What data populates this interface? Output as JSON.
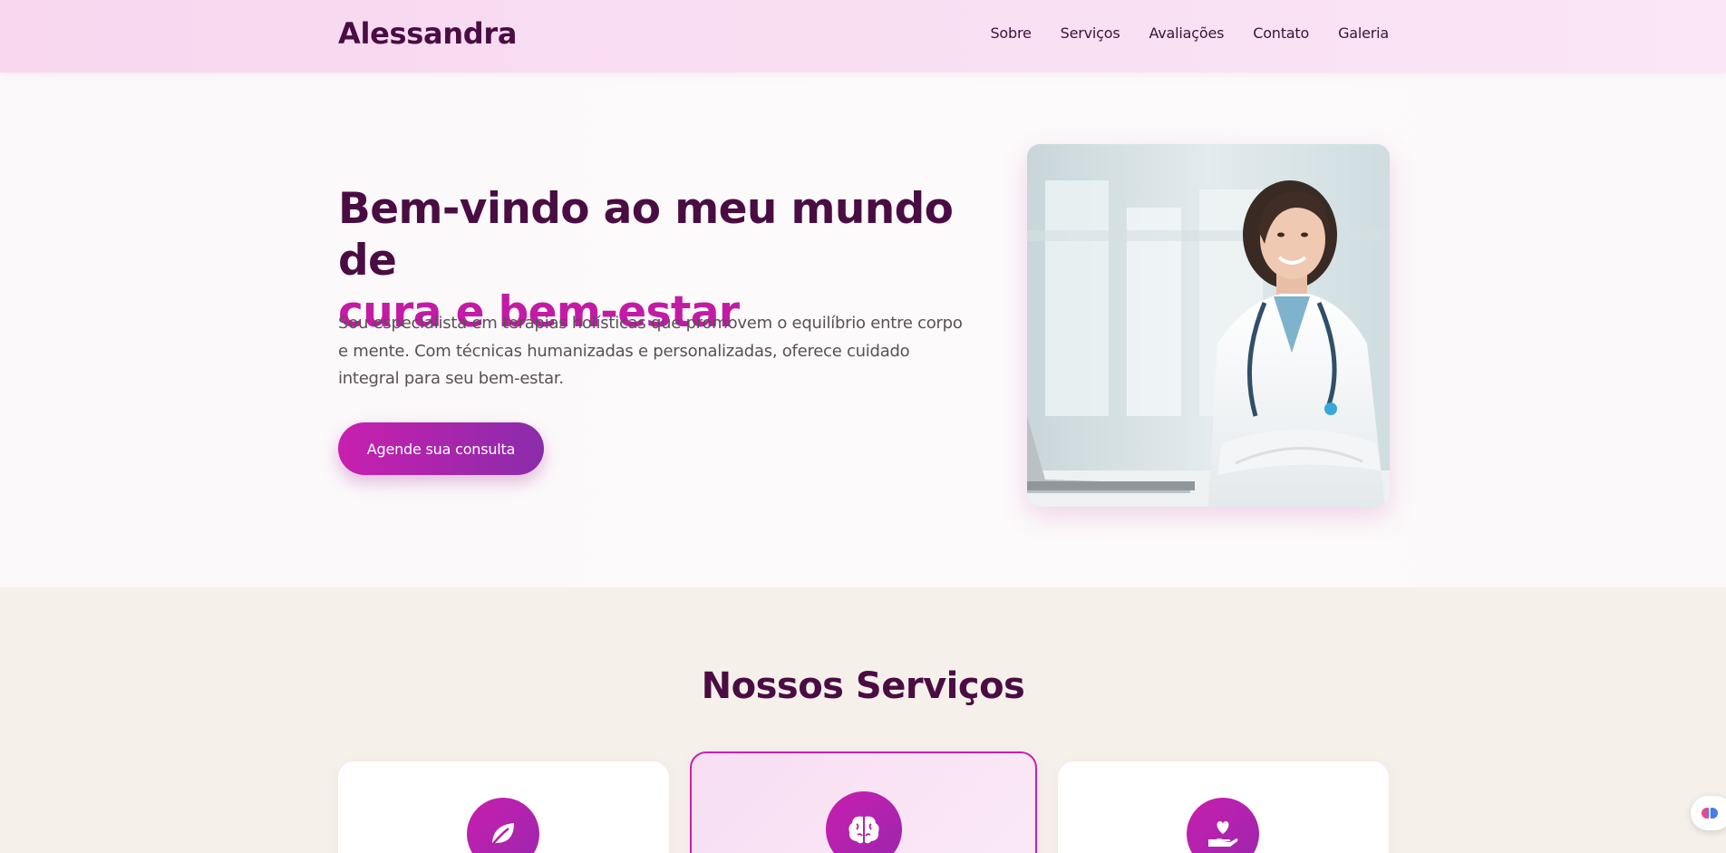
{
  "header": {
    "logo": "Alessandra",
    "nav": [
      "Sobre",
      "Serviços",
      "Avaliações",
      "Contato",
      "Galeria"
    ]
  },
  "hero": {
    "title_line1": "Bem-vindo ao meu mundo de",
    "title_line2": "cura e bem-estar",
    "description": "Sou especialista em terapias holísticas que promovem o equilíbrio entre corpo e mente. Com técnicas humanizadas e personalizadas, oferece cuidado integral para seu bem-estar.",
    "cta_label": "Agende sua consulta"
  },
  "services": {
    "title": "Nossos Serviços",
    "cards": [
      {
        "icon": "leaf-icon"
      },
      {
        "icon": "brain-icon",
        "highlighted": true
      },
      {
        "icon": "hand-heart-icon"
      }
    ]
  },
  "colors": {
    "primary": "#c81fae",
    "primary_dark": "#4a0d43",
    "secondary": "#8a2cab",
    "header_bg": "#f8d7ef",
    "section_bg": "#f6f0ea"
  },
  "floating_button": {
    "icon": "brain-icon"
  }
}
